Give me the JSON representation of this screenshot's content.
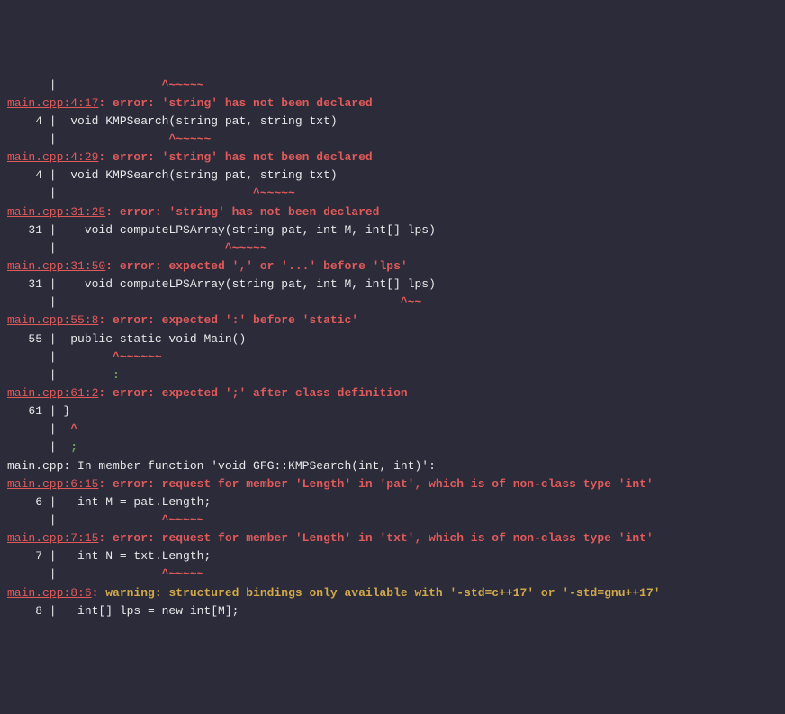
{
  "entries": [
    {
      "indent": "      |               ",
      "hat": "^~~~~~"
    },
    {
      "loc": "main.cpp:4:17",
      "kind": "error",
      "msg": "'string' has not been declared"
    },
    {
      "gutter": "    4 |  ",
      "code": "void KMPSearch(string pat, string txt)"
    },
    {
      "indent": "      |                ",
      "hat": "^~~~~~"
    },
    {
      "loc": "main.cpp:4:29",
      "kind": "error",
      "msg": "'string' has not been declared"
    },
    {
      "gutter": "    4 |  ",
      "code": "void KMPSearch(string pat, string txt)"
    },
    {
      "indent": "      |                            ",
      "hat": "^~~~~~"
    },
    {
      "loc": "main.cpp:31:25",
      "kind": "error",
      "msg": "'string' has not been declared"
    },
    {
      "gutter": "   31 |    ",
      "code": "void computeLPSArray(string pat, int M, int[] lps)"
    },
    {
      "indent": "      |                        ",
      "hat": "^~~~~~"
    },
    {
      "loc": "main.cpp:31:50",
      "kind": "error",
      "msg": "expected ',' or '...' before 'lps'"
    },
    {
      "gutter": "   31 |    ",
      "code": "void computeLPSArray(string pat, int M, int[] lps)"
    },
    {
      "indent": "      |                                                 ",
      "hat": "^~~"
    },
    {
      "loc": "main.cpp:55:8",
      "kind": "error",
      "msg": "expected ':' before 'static'"
    },
    {
      "gutter": "   55 |  ",
      "code": "public static void Main()"
    },
    {
      "indent": "      |        ",
      "hat": "^~~~~~~"
    },
    {
      "indent": "      |        ",
      "fix": ":"
    },
    {
      "loc": "main.cpp:61:2",
      "kind": "error",
      "msg": "expected ';' after class definition"
    },
    {
      "gutter": "   61 | ",
      "code": "}"
    },
    {
      "indent": "      |  ",
      "hat": "^"
    },
    {
      "indent": "      |  ",
      "fix": ";"
    },
    {
      "note": "main.cpp: In member function 'void GFG::KMPSearch(int, int)':"
    },
    {
      "loc": "main.cpp:6:15",
      "kind": "error",
      "msg": "request for member 'Length' in 'pat', which is of non-class type 'int'"
    },
    {
      "gutter": "    6 |   ",
      "code": "int M = pat.Length;"
    },
    {
      "indent": "      |               ",
      "hat": "^~~~~~"
    },
    {
      "loc": "main.cpp:7:15",
      "kind": "error",
      "msg": "request for member 'Length' in 'txt', which is of non-class type 'int'"
    },
    {
      "gutter": "    7 |   ",
      "code": "int N = txt.Length;"
    },
    {
      "indent": "      |               ",
      "hat": "^~~~~~"
    },
    {
      "loc": "main.cpp:8:6",
      "kind": "warning",
      "msg": "structured bindings only available with '-std=c++17' or '-std=gnu++17'"
    },
    {
      "gutter": "    8 |   ",
      "code": "int[] lps = new int[M];"
    }
  ]
}
